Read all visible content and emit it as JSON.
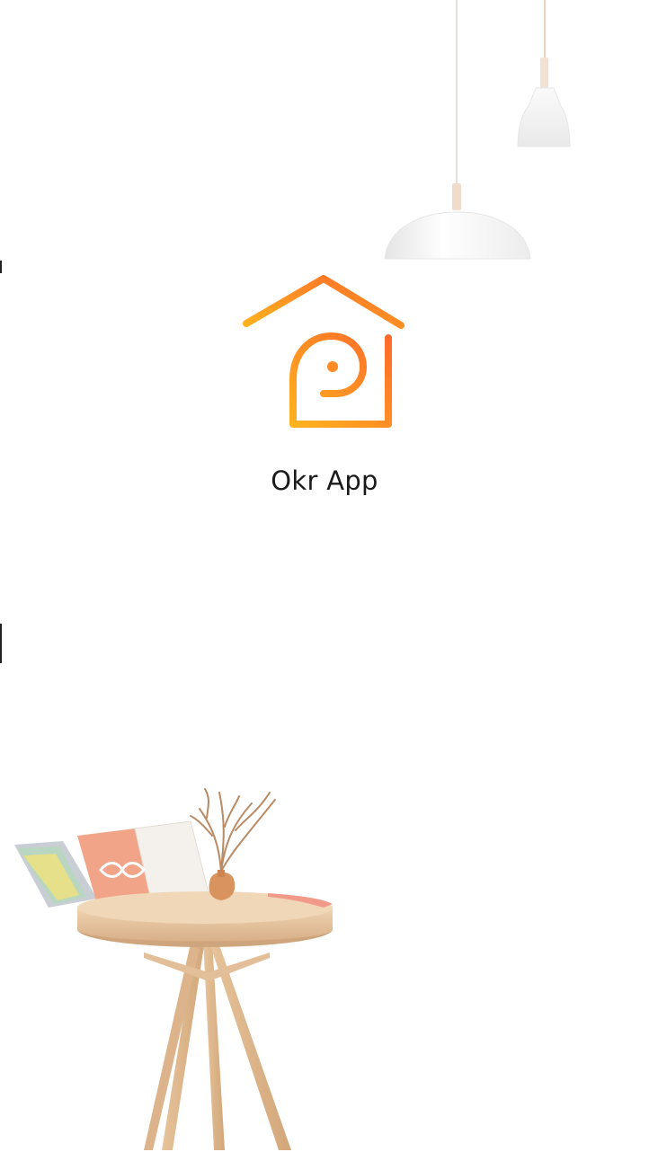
{
  "app": {
    "name": "Okr App"
  },
  "logo": {
    "icon": "house-logo-icon",
    "gradient_start": "#FFB21E",
    "gradient_end": "#FF6A2B"
  },
  "illustrations": {
    "top": "pendant-lamps-illustration",
    "bottom": "side-table-illustration"
  },
  "colors": {
    "background": "#FFFFFF",
    "text": "#1A1A1A",
    "wood": "#E9C8A0"
  }
}
